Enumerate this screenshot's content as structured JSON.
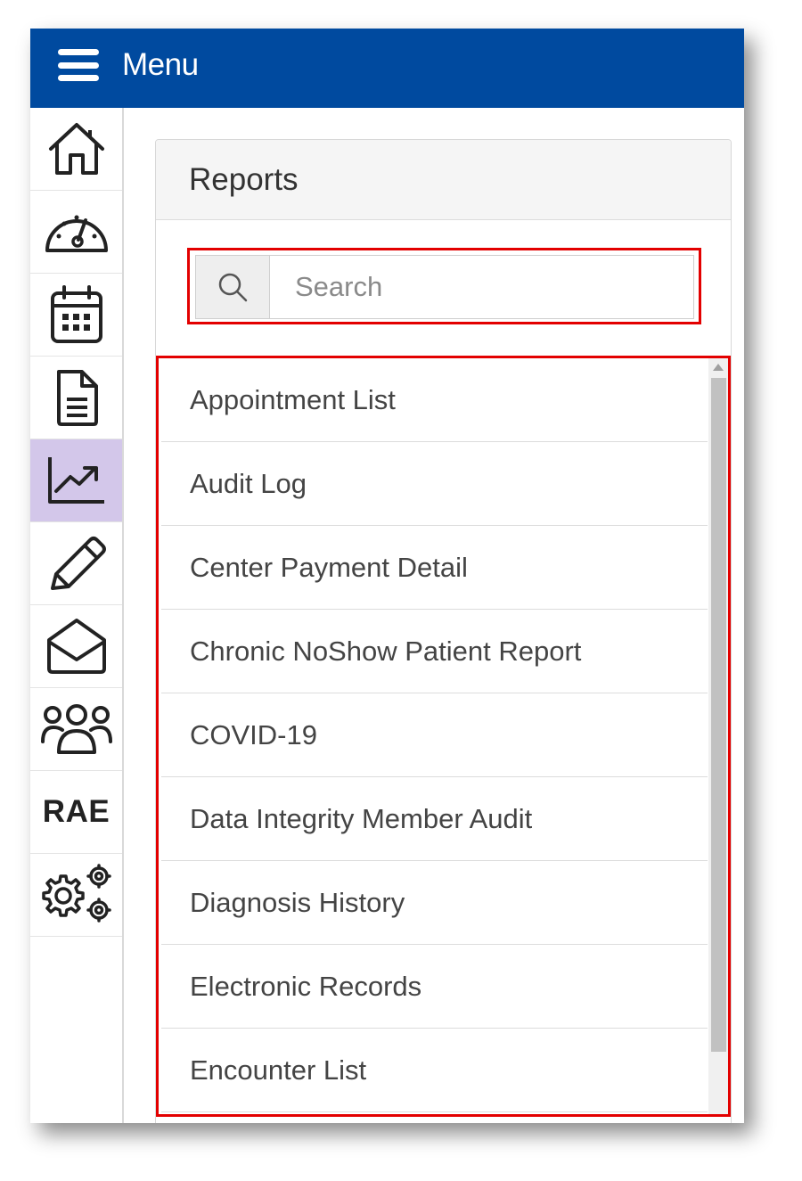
{
  "topbar": {
    "menu_label": "Menu",
    "color": "#004a9f"
  },
  "sidebar": {
    "items": [
      {
        "icon": "home-icon"
      },
      {
        "icon": "dashboard-gauge-icon"
      },
      {
        "icon": "calendar-icon"
      },
      {
        "icon": "document-icon"
      },
      {
        "icon": "reports-chart-icon",
        "active": true
      },
      {
        "icon": "pencil-icon"
      },
      {
        "icon": "mail-open-icon"
      },
      {
        "icon": "users-group-icon"
      },
      {
        "label": "RAE"
      },
      {
        "icon": "settings-gears-icon"
      }
    ],
    "active_color": "#d3c7ea"
  },
  "reports": {
    "title": "Reports",
    "search": {
      "placeholder": "Search",
      "value": ""
    },
    "items": [
      "Appointment List",
      "Audit Log",
      "Center Payment Detail",
      "Chronic NoShow Patient Report",
      "COVID-19",
      "Data Integrity Member Audit",
      "Diagnosis History",
      "Electronic Records",
      "Encounter List"
    ]
  },
  "highlight_color": "#e30000"
}
